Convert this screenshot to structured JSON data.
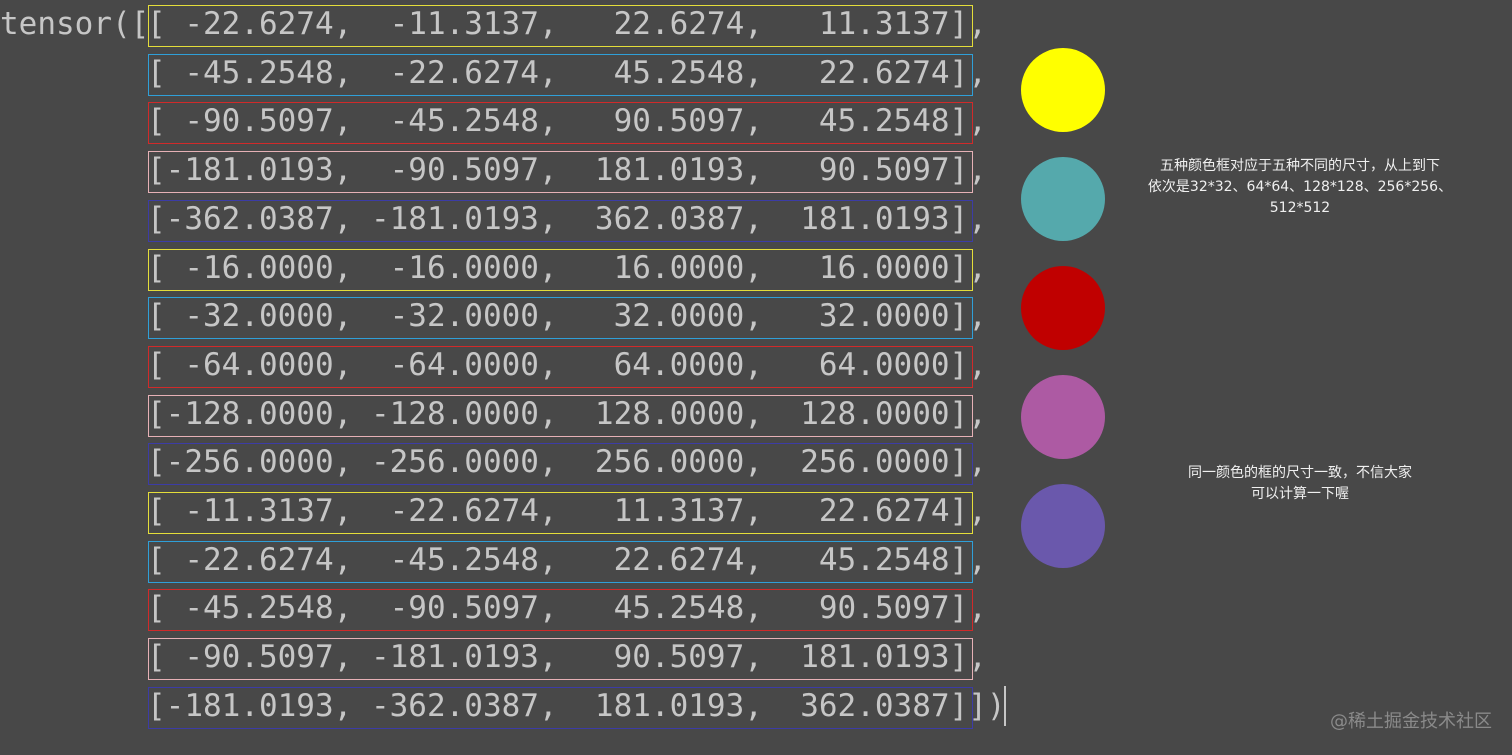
{
  "prefix": "tensor([",
  "rows": [
    {
      "text": "[ -22.6274,  -11.3137,   22.6274,   11.3137],",
      "color": "#e4dd3a"
    },
    {
      "text": "[ -45.2548,  -22.6274,   45.2548,   22.6274],",
      "color": "#2f9fd8"
    },
    {
      "text": "[ -90.5097,  -45.2548,   90.5097,   45.2548],",
      "color": "#d02a2a"
    },
    {
      "text": "[-181.0193,  -90.5097,  181.0193,   90.5097],",
      "color": "#e6b1b6"
    },
    {
      "text": "[-362.0387, -181.0193,  362.0387,  181.0193],",
      "color": "#3c3ca6"
    },
    {
      "text": "[ -16.0000,  -16.0000,   16.0000,   16.0000],",
      "color": "#e4dd3a"
    },
    {
      "text": "[ -32.0000,  -32.0000,   32.0000,   32.0000],",
      "color": "#2f9fd8"
    },
    {
      "text": "[ -64.0000,  -64.0000,   64.0000,   64.0000],",
      "color": "#d02a2a"
    },
    {
      "text": "[-128.0000, -128.0000,  128.0000,  128.0000],",
      "color": "#e6b1b6"
    },
    {
      "text": "[-256.0000, -256.0000,  256.0000,  256.0000],",
      "color": "#3c3ca6"
    },
    {
      "text": "[ -11.3137,  -22.6274,   11.3137,   22.6274],",
      "color": "#e4dd3a"
    },
    {
      "text": "[ -22.6274,  -45.2548,   22.6274,   45.2548],",
      "color": "#2f9fd8"
    },
    {
      "text": "[ -45.2548,  -90.5097,   45.2548,   90.5097],",
      "color": "#d02a2a"
    },
    {
      "text": "[ -90.5097, -181.0193,   90.5097,  181.0193],",
      "color": "#e6b1b6"
    },
    {
      "text": "[-181.0193, -362.0387,  181.0193,  362.0387]])",
      "color": "#3c3ca6"
    }
  ],
  "legend_colors": [
    {
      "name": "yellow",
      "color": "#ffff00"
    },
    {
      "name": "teal",
      "color": "#55a9ac"
    },
    {
      "name": "red",
      "color": "#c00000"
    },
    {
      "name": "pink",
      "color": "#ad5aa3"
    },
    {
      "name": "purple",
      "color": "#6a58ac"
    }
  ],
  "note1": {
    "line1": "五种颜色框对应于五种不同的尺寸，从上到下",
    "line2": "依次是32*32、64*64、128*128、256*256、",
    "line3": "512*512"
  },
  "note2": {
    "line1": "同一颜色的框的尺寸一致，不信大家",
    "line2": "可以计算一下喔"
  },
  "watermark": "@稀土掘金技术社区"
}
